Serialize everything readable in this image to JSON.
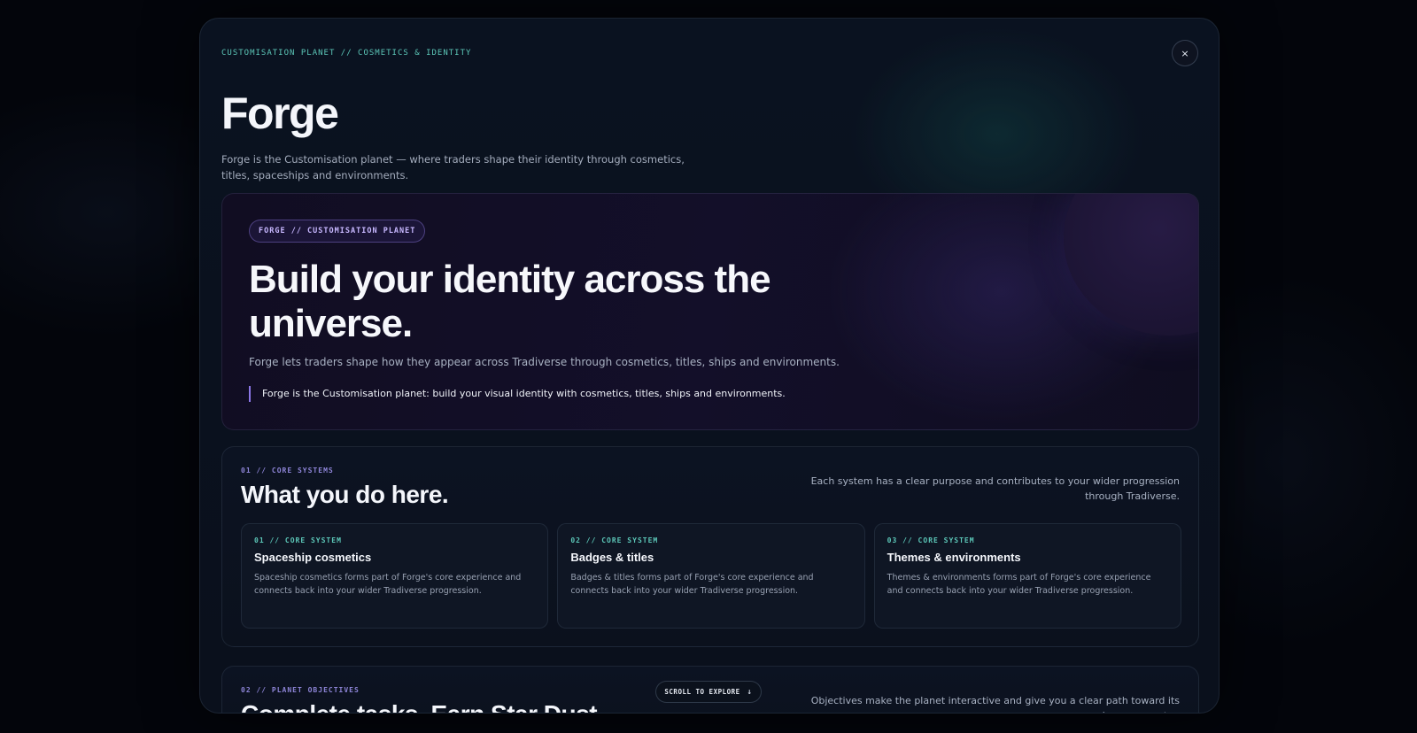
{
  "header": {
    "eyebrow": "CUSTOMISATION PLANET // COSMETICS & IDENTITY",
    "title": "Forge",
    "description": "Forge is the Customisation planet — where traders shape their identity through cosmetics, titles, spaceships and environments.",
    "close_label": "×"
  },
  "hero": {
    "chip": "FORGE // CUSTOMISATION PLANET",
    "title": "Build your identity across the universe.",
    "subtitle": "Forge lets traders shape how they appear across Tradiverse through cosmetics, titles, ships and environments.",
    "quote": "Forge is the Customisation planet: build your visual identity with cosmetics, titles, ships and environments."
  },
  "core_systems": {
    "label": "01 // CORE SYSTEMS",
    "title": "What you do here.",
    "description": "Each system has a clear purpose and contributes to your wider progression through Tradiverse.",
    "cards": [
      {
        "label": "01 // CORE SYSTEM",
        "title": "Spaceship cosmetics",
        "description": "Spaceship cosmetics forms part of Forge's core experience and connects back into your wider Tradiverse progression."
      },
      {
        "label": "02 // CORE SYSTEM",
        "title": "Badges & titles",
        "description": "Badges & titles forms part of Forge's core experience and connects back into your wider Tradiverse progression."
      },
      {
        "label": "03 // CORE SYSTEM",
        "title": "Themes & environments",
        "description": "Themes & environments forms part of Forge's core experience and connects back into your wider Tradiverse progression."
      }
    ]
  },
  "objectives": {
    "label": "02 // PLANET OBJECTIVES",
    "title": "Complete tasks. Earn Star Dust.",
    "description": "Objectives make the planet interactive and give you a clear path toward its boss encounter."
  },
  "scroll": {
    "label": "SCROLL TO EXPLORE",
    "arrow": "↓"
  },
  "colors": {
    "accent_teal": "#5cc7b8",
    "accent_violet": "#8b76e6",
    "background": "#03050b",
    "panel": "#0a1220"
  }
}
